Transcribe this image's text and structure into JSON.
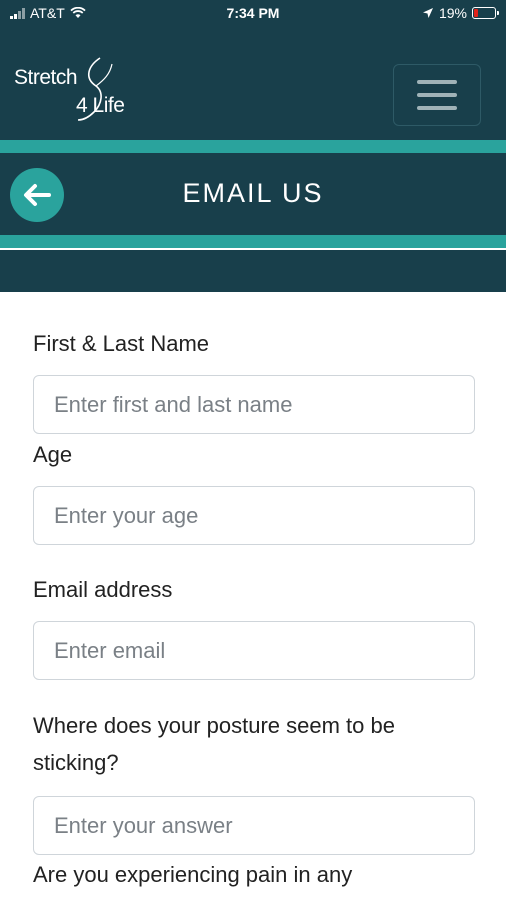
{
  "status_bar": {
    "carrier": "AT&T",
    "time": "7:34 PM",
    "battery": "19%",
    "battery_level_fraction": 0.19,
    "icons": [
      "signal-icon",
      "wifi-icon",
      "location-arrow-icon",
      "battery-icon"
    ]
  },
  "header": {
    "logo_line1": "Stretch",
    "logo_line2": "4 Life",
    "menu_icon": "hamburger-icon"
  },
  "page": {
    "title": "EMAIL US",
    "back_icon": "arrow-left-icon"
  },
  "form": {
    "fields": [
      {
        "label": "First & Last Name",
        "placeholder": "Enter first and last name",
        "value": ""
      },
      {
        "label": "Age",
        "placeholder": "Enter your age",
        "value": ""
      },
      {
        "label": "Email address",
        "placeholder": "Enter email",
        "value": ""
      },
      {
        "label": "Where does your posture seem to be sticking?",
        "placeholder": "Enter your answer",
        "value": ""
      },
      {
        "label": "Are you experiencing pain in any"
      }
    ]
  },
  "colors": {
    "header_bg": "#183f4b",
    "accent_teal": "#2aa39d",
    "battery_low": "#e2231a"
  }
}
